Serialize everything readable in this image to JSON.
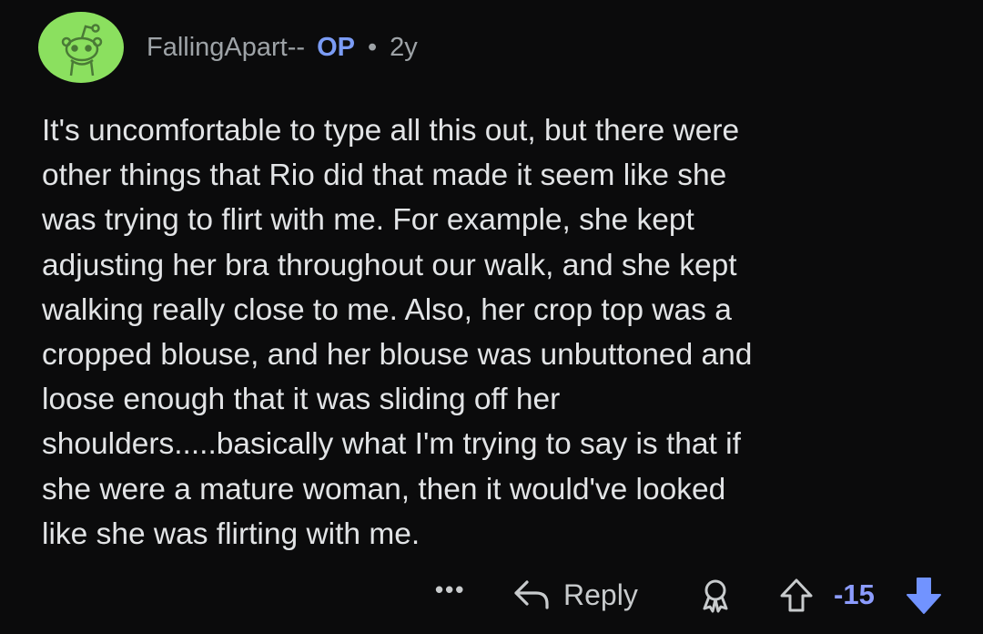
{
  "comment": {
    "author": "FallingApart--",
    "op_badge": "OP",
    "separator": "•",
    "age": "2y",
    "lines": [
      "It's uncomfortable to type all this out, but there were",
      "other things that Rio did that made it seem like she",
      "was trying to flirt with me. For example, she kept",
      "adjusting her bra throughout our walk, and she kept",
      "walking really close to me. Also, her crop top was a",
      "cropped blouse, and her blouse was unbuttoned and",
      "loose enough that it was sliding off her",
      "shoulders.....basically what I'm trying to say is that if",
      "she were a mature woman, then it would've looked",
      "like she was flirting with me."
    ]
  },
  "actions": {
    "more_label": "•••",
    "reply_label": "Reply",
    "score": "-15"
  },
  "colors": {
    "background": "#0b0b0c",
    "avatar_bg": "#8be05f",
    "op_color": "#7b9cf5",
    "score_color": "#8c9cff",
    "downvote_color": "#7193ff"
  },
  "icons": {
    "avatar": "snoo-avatar-icon",
    "reply": "reply-arrow-icon",
    "award": "award-icon",
    "upvote": "upvote-arrow-icon",
    "downvote": "downvote-arrow-icon"
  }
}
